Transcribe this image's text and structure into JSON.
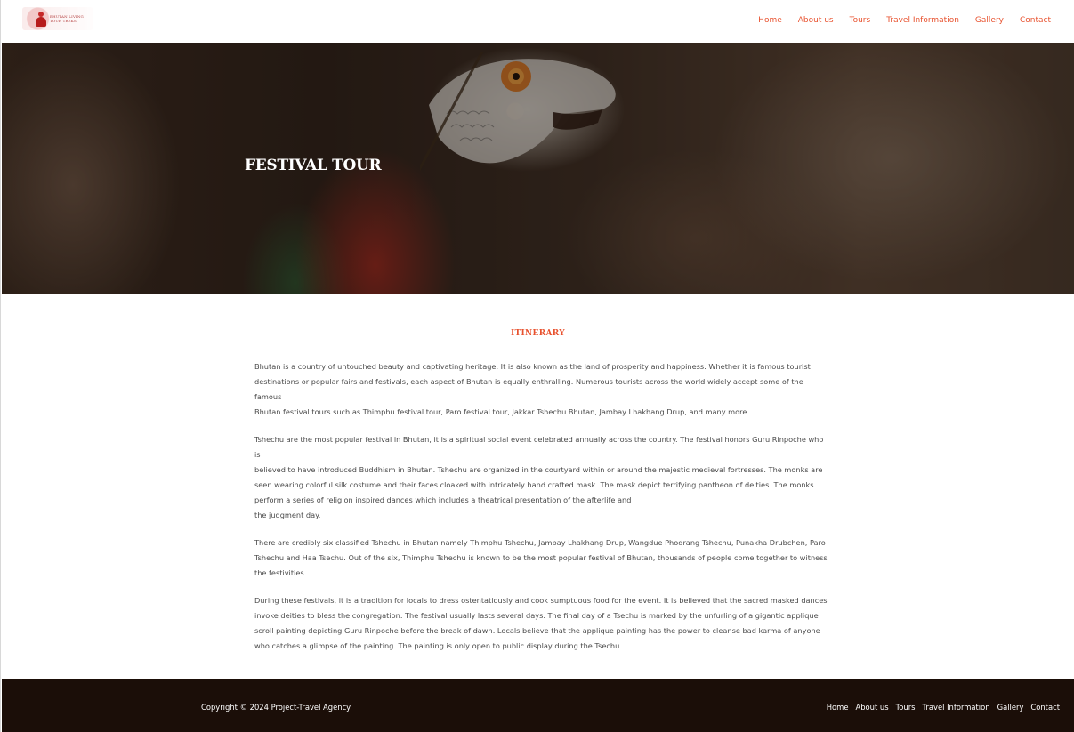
{
  "header": {
    "logo_text": "BHUTAN LIVING TOUR TREKS",
    "nav": [
      "Home",
      "About us",
      "Tours",
      "Travel Information",
      "Gallery",
      "Contact"
    ]
  },
  "hero": {
    "title": "FESTIVAL TOUR"
  },
  "main": {
    "heading": "ITINERARY",
    "paragraphs": [
      [
        "Bhutan is a country of untouched beauty and captivating heritage. It is also known as the land of prosperity and happiness. Whether it is famous tourist",
        "destinations or popular fairs and festivals, each aspect of Bhutan is equally enthralling. Numerous tourists across the world widely accept some of the famous",
        "Bhutan festival tours such as Thimphu festival tour, Paro festival tour, Jakkar Tshechu Bhutan, Jambay Lhakhang Drup, and many more."
      ],
      [
        "Tshechu are the most popular festival in Bhutan, it is a spiritual social event celebrated annually across the country. The festival honors Guru Rinpoche who is",
        "believed to have introduced Buddhism in Bhutan. Tshechu are organized in the courtyard within or around the majestic medieval fortresses. The monks are",
        "seen wearing colorful silk costume and their faces cloaked with intricately hand crafted mask. The mask depict terrifying pantheon of deities. The monks",
        "perform a series of religion inspired dances which includes a theatrical presentation of the afterlife and",
        "the judgment day."
      ],
      [
        "There are credibly six classified Tshechu in Bhutan namely Thimphu Tshechu, Jambay Lhakhang Drup, Wangdue Phodrang Tshechu, Punakha Drubchen, Paro",
        "Tshechu and Haa Tsechu. Out of the six, Thimphu Tshechu is known to be the most popular festival of Bhutan, thousands of people come together to witness",
        "the festivities."
      ],
      [
        "During these festivals, it is a tradition for locals to dress ostentatiously and cook sumptuous food for the event. It is believed that the sacred masked dances",
        "invoke deities to bless the congregation. The festival usually lasts several days. The final day of a Tsechu is marked by the unfurling of a gigantic applique",
        "scroll painting depicting Guru Rinpoche before the break of dawn. Locals believe that the applique painting has the power to cleanse bad karma of anyone",
        "who catches a glimpse of the painting. The painting is only open to public display during the Tsechu."
      ]
    ]
  },
  "footer": {
    "copyright": "Copyright © 2024 Project-Travel Agency",
    "nav": [
      "Home",
      "About us",
      "Tours",
      "Travel Information",
      "Gallery",
      "Contact"
    ]
  },
  "colors": {
    "accent": "#e8522f",
    "footer_bg": "#1b0e08"
  }
}
